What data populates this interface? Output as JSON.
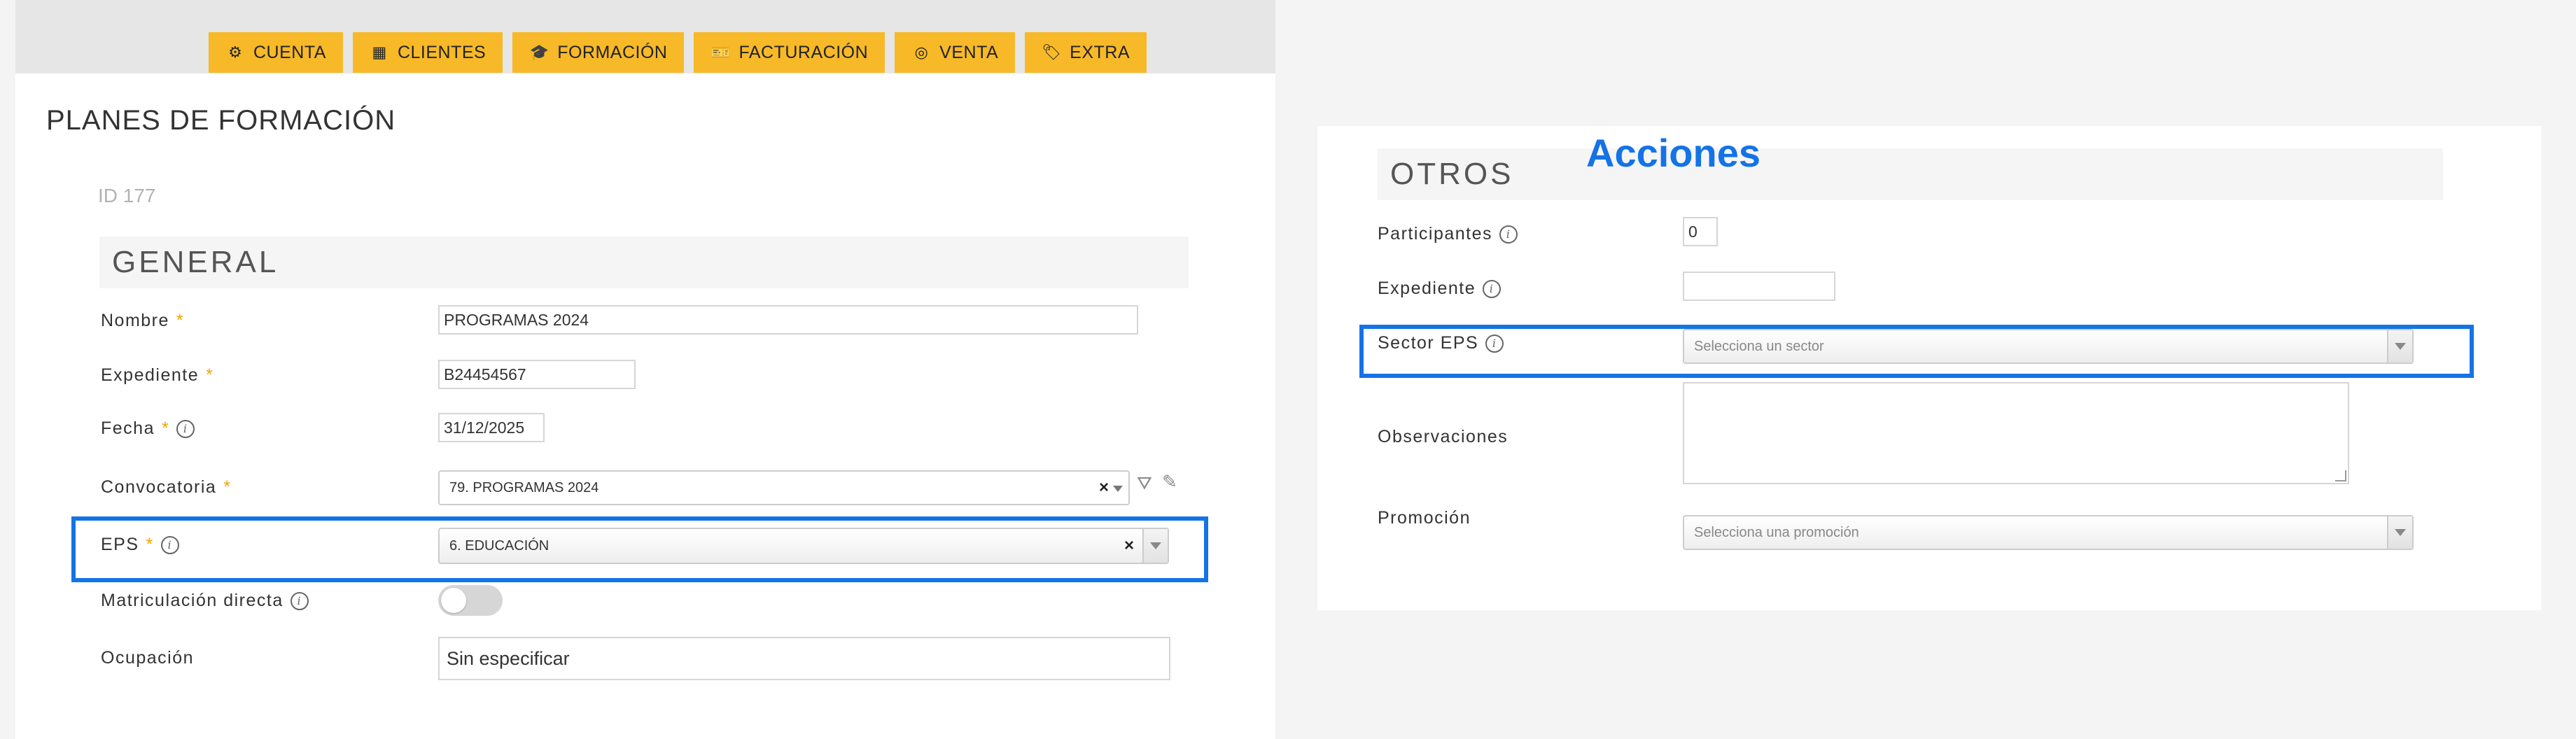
{
  "nav": {
    "items": [
      {
        "label": "CUENTA",
        "icon": "gears-icon",
        "glyph": "⚙"
      },
      {
        "label": "CLIENTES",
        "icon": "building-icon",
        "glyph": "▦"
      },
      {
        "label": "FORMACIÓN",
        "icon": "graduation-cap-icon",
        "glyph": "🎓"
      },
      {
        "label": "FACTURACIÓN",
        "icon": "ticket-icon",
        "glyph": "🎫"
      },
      {
        "label": "VENTA",
        "icon": "target-icon",
        "glyph": "◎"
      },
      {
        "label": "EXTRA",
        "icon": "tag-icon",
        "glyph": "🏷"
      }
    ]
  },
  "page": {
    "title": "PLANES DE FORMACIÓN",
    "record_id": "ID 177"
  },
  "general": {
    "header": "GENERAL",
    "nombre": {
      "label": "Nombre",
      "required": "*",
      "value": "PROGRAMAS 2024"
    },
    "expediente": {
      "label": "Expediente",
      "required": "*",
      "value": "B24454567"
    },
    "fecha": {
      "label": "Fecha",
      "required": "*",
      "value": "31/12/2025"
    },
    "convocatoria": {
      "label": "Convocatoria",
      "required": "*",
      "value": "79. PROGRAMAS 2024",
      "clear": "×"
    },
    "eps": {
      "label": "EPS",
      "required": "*",
      "value": "6. EDUCACIÓN",
      "clear": "×"
    },
    "matriculacion": {
      "label": "Matriculación directa",
      "enabled": false
    },
    "ocupacion": {
      "label": "Ocupación",
      "value": "Sin especificar"
    }
  },
  "otros": {
    "header": "OTROS",
    "overlay_label": "Acciones",
    "participantes": {
      "label": "Participantes",
      "value": "0"
    },
    "expediente": {
      "label": "Expediente",
      "value": ""
    },
    "sector_eps": {
      "label": "Sector EPS",
      "placeholder": "Selecciona un sector"
    },
    "observaciones": {
      "label": "Observaciones",
      "value": ""
    },
    "promocion": {
      "label": "Promoción",
      "placeholder": "Selecciona una promoción"
    }
  },
  "colors": {
    "nav_bg": "#f7b928",
    "highlight": "#1473e6",
    "required": "#f0a500"
  }
}
